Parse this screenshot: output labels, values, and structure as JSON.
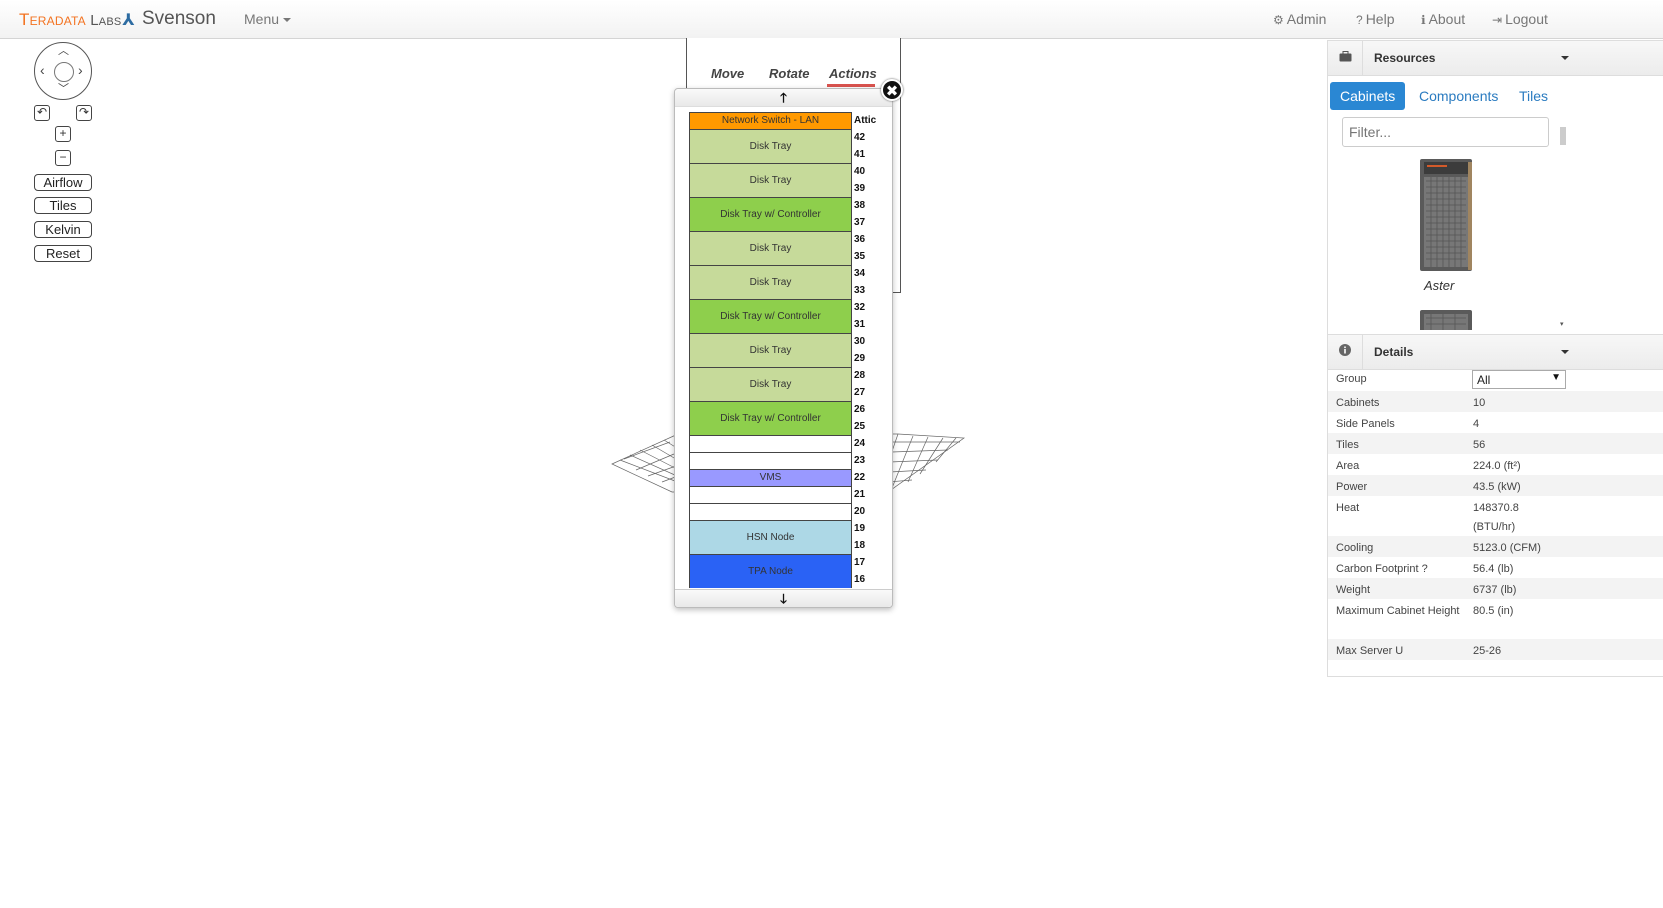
{
  "header": {
    "logo_part1": "Teradata",
    "logo_part2": "Labs",
    "logo_mark": "⅄",
    "brand": "Svenson",
    "menu_label": "Menu",
    "links": [
      {
        "icon": "⚙",
        "label": "Admin"
      },
      {
        "icon": "?",
        "label": "Help"
      },
      {
        "icon": "ℹ",
        "label": "About"
      },
      {
        "icon": "⇥",
        "label": "Logout"
      }
    ]
  },
  "controls": {
    "zoom_in": "+",
    "zoom_out": "−",
    "undo": "↶",
    "redo": "↷",
    "buttons": [
      "Airflow",
      "Tiles",
      "Kelvin",
      "Reset"
    ]
  },
  "editor": {
    "tabs": [
      "Move",
      "Rotate",
      "Actions"
    ],
    "accent": "#d9534f"
  },
  "rack": {
    "up_label": "🡑",
    "down_label": "🡓",
    "close_label": "✖",
    "attic_label": "Attic",
    "units": [
      "42",
      "41",
      "40",
      "39",
      "38",
      "37",
      "36",
      "35",
      "34",
      "33",
      "32",
      "31",
      "30",
      "29",
      "28",
      "27",
      "26",
      "25",
      "24",
      "23",
      "22",
      "21",
      "20",
      "19",
      "18",
      "17",
      "16"
    ],
    "slots": [
      {
        "label": "Network Switch - LAN",
        "color": "#ff9900"
      },
      {
        "label": "Disk Tray",
        "color": "#c6da9a"
      },
      {
        "label": "Disk Tray",
        "color": "#c6da9a"
      },
      {
        "label": "Disk Tray w/ Controller",
        "color": "#8ecf4c"
      },
      {
        "label": "Disk Tray",
        "color": "#c6da9a"
      },
      {
        "label": "Disk Tray",
        "color": "#c6da9a"
      },
      {
        "label": "Disk Tray w/ Controller",
        "color": "#8ecf4c"
      },
      {
        "label": "Disk Tray",
        "color": "#c6da9a"
      },
      {
        "label": "Disk Tray",
        "color": "#c6da9a"
      },
      {
        "label": "Disk Tray w/ Controller",
        "color": "#8ecf4c"
      },
      {
        "label": "",
        "color": "#ffffff"
      },
      {
        "label": "",
        "color": "#ffffff"
      },
      {
        "label": "VMS",
        "color": "#9999ff"
      },
      {
        "label": "",
        "color": "#ffffff"
      },
      {
        "label": "",
        "color": "#ffffff"
      },
      {
        "label": "HSN Node",
        "color": "#add8e6"
      },
      {
        "label": "TPA Node",
        "color": "#2a62f5"
      }
    ]
  },
  "resources": {
    "title": "Resources",
    "icon": "briefcase-icon",
    "tabs": [
      "Cabinets",
      "Components",
      "Tiles"
    ],
    "active_tab": "Cabinets",
    "filter_placeholder": "Filter...",
    "items": [
      {
        "label": "Aster"
      }
    ]
  },
  "details": {
    "title": "Details",
    "icon": "info-icon",
    "group_label": "Group",
    "group_value": "All",
    "rows": [
      {
        "k": "Cabinets",
        "v": "10"
      },
      {
        "k": "Side Panels",
        "v": "4"
      },
      {
        "k": "Tiles",
        "v": "56"
      },
      {
        "k": "Area",
        "v": "224.0 (ft²)"
      },
      {
        "k": "Power",
        "v": "43.5 (kW)"
      },
      {
        "k": "Heat",
        "v": "148370.8 (BTU/hr)"
      },
      {
        "k": "Cooling",
        "v": "5123.0 (CFM)"
      },
      {
        "k": "Carbon Footprint ?",
        "v": "56.4 (lb)"
      },
      {
        "k": "Weight",
        "v": "6737 (lb)"
      },
      {
        "k": "Maximum Cabinet Height",
        "v": "80.5 (in)"
      },
      {
        "k": "Max Server U",
        "v": "25-26"
      }
    ]
  }
}
